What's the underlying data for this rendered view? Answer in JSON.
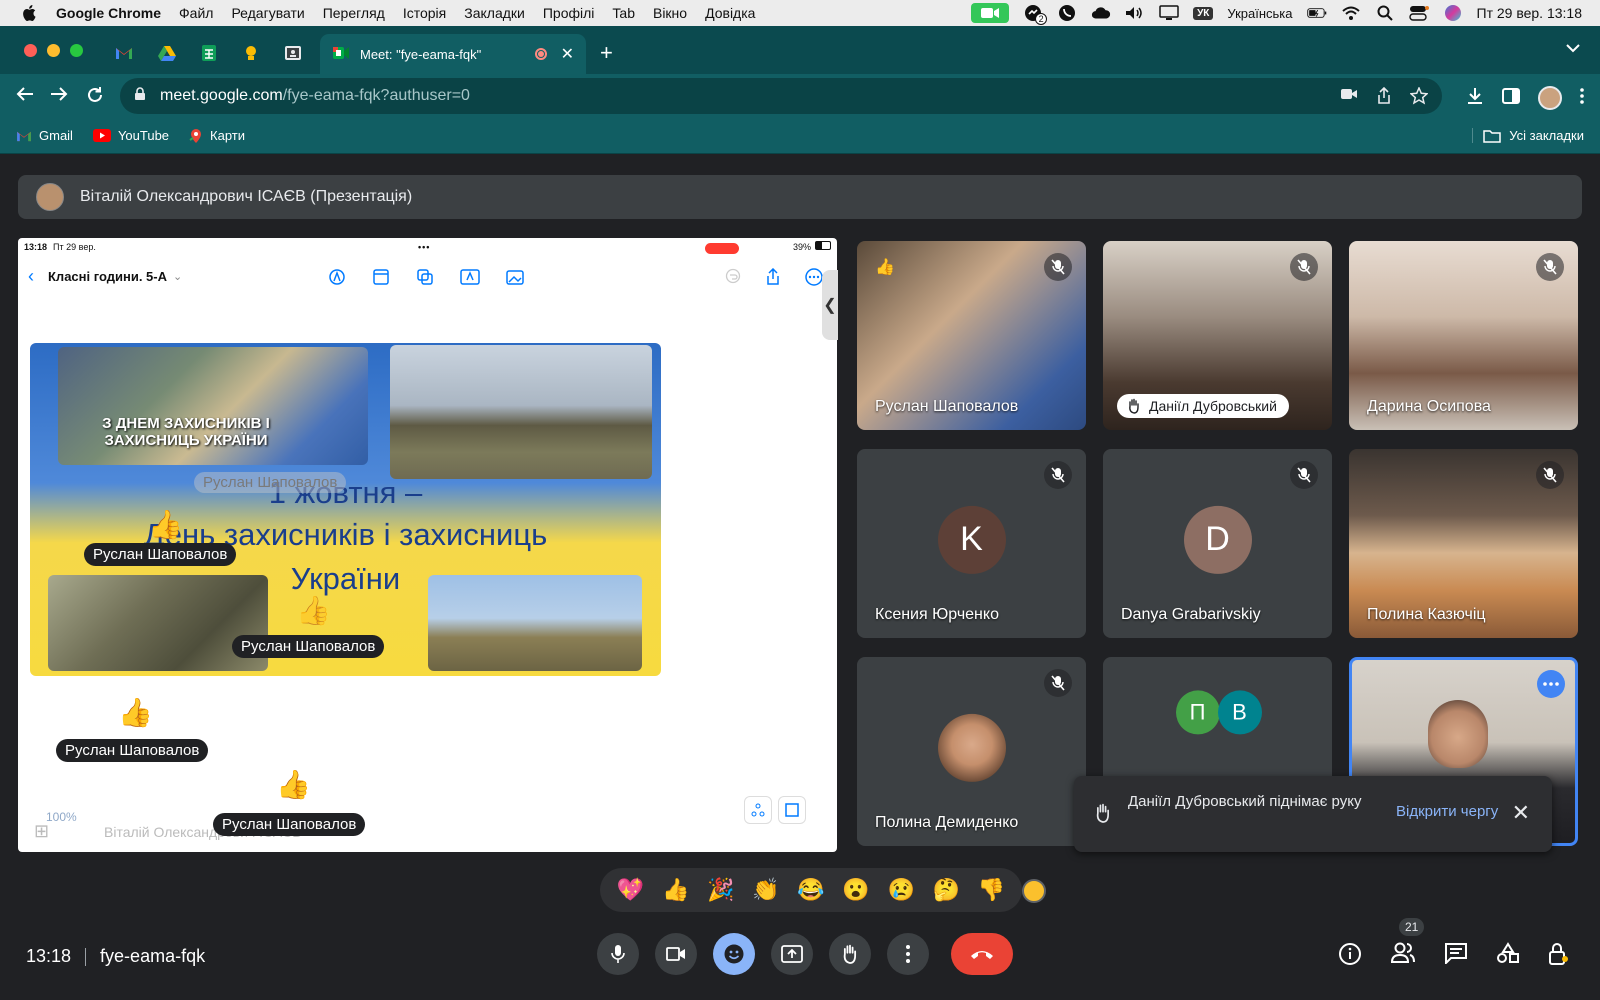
{
  "menubar": {
    "app": "Google Chrome",
    "items": [
      "Файл",
      "Редагувати",
      "Перегляд",
      "Історія",
      "Закладки",
      "Профілі",
      "Tab",
      "Вікно",
      "Довідка"
    ],
    "keyboard_short": "УК",
    "keyboard": "Українська",
    "datetime": "Пт 29 вер.  13:18",
    "notif_count": "2"
  },
  "browser": {
    "active_tab_title": "Meet: \"fye-eama-fqk\"",
    "url_host": "meet.google.com",
    "url_path": "/fye-eama-fqk?authuser=0",
    "bookmarks": [
      "Gmail",
      "YouTube",
      "Карти"
    ],
    "all_bookmarks": "Усі закладки"
  },
  "meet": {
    "presenter": "Віталій Олександрович ІСАЄВ (Презентація)",
    "slide": {
      "status_time": "13:18",
      "status_date": "Пт 29 вер.",
      "battery": "39%",
      "board_name": "Класні години. 5-А",
      "poster_heading": "З ДНЕМ ЗАХИСНИКІВ І ЗАХИСНИЦЬ УКРАЇНИ",
      "poster_line1": "1 жовтня –",
      "poster_line2": "День захисників і захисниць",
      "poster_line3": "України",
      "footer_zoom": "100%",
      "footer_name": "Віталій Олександрович ІСАЄВ",
      "reaction_name": "Руслан Шаповалов"
    },
    "tiles": [
      {
        "name": "Руслан Шаповалов"
      },
      {
        "name": "Даніїл Дубровський"
      },
      {
        "name": "Дарина Осипова"
      },
      {
        "name": "Ксения Юрченко",
        "initial": "K"
      },
      {
        "name": "Danya Grabarivskiy",
        "initial": "D"
      },
      {
        "name": "Полина Казючіц"
      },
      {
        "name": "Полина Демиденко"
      },
      {
        "initials": [
          "П",
          "В"
        ]
      },
      {}
    ],
    "toast": {
      "text": "Даніїл Дубровський піднімає руку",
      "action": "Відкрити чергу"
    },
    "reactions": [
      "💖",
      "👍",
      "🎉",
      "👏",
      "😂",
      "😮",
      "😢",
      "🤔",
      "👎"
    ],
    "time": "13:18",
    "meeting_code": "fye-eama-fqk",
    "participants_count": "21"
  }
}
